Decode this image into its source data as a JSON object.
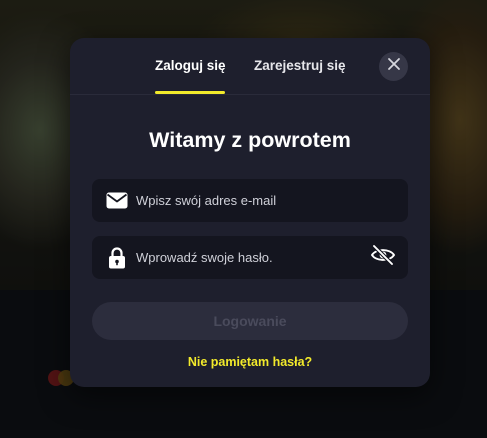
{
  "modal": {
    "tabs": [
      {
        "label": "Zaloguj się",
        "active": true
      },
      {
        "label": "Zarejestruj się",
        "active": false
      }
    ],
    "title": "Witamy z powrotem",
    "email": {
      "placeholder": "Wpisz swój adres e-mail",
      "value": ""
    },
    "password": {
      "placeholder": "Wprowadź swoje hasło.",
      "value": ""
    },
    "login_button": "Logowanie",
    "forgot_link": "Nie pamiętam hasła?"
  },
  "icons": [
    "close-icon",
    "envelope-icon",
    "lock-icon",
    "eye-off-icon"
  ],
  "colors": {
    "modal_bg": "#1e1f2d",
    "input_bg": "#14151f",
    "accent": "#f2ea2b",
    "button_disabled_bg": "#2c2d3d",
    "button_disabled_text": "#4a4b5c"
  }
}
